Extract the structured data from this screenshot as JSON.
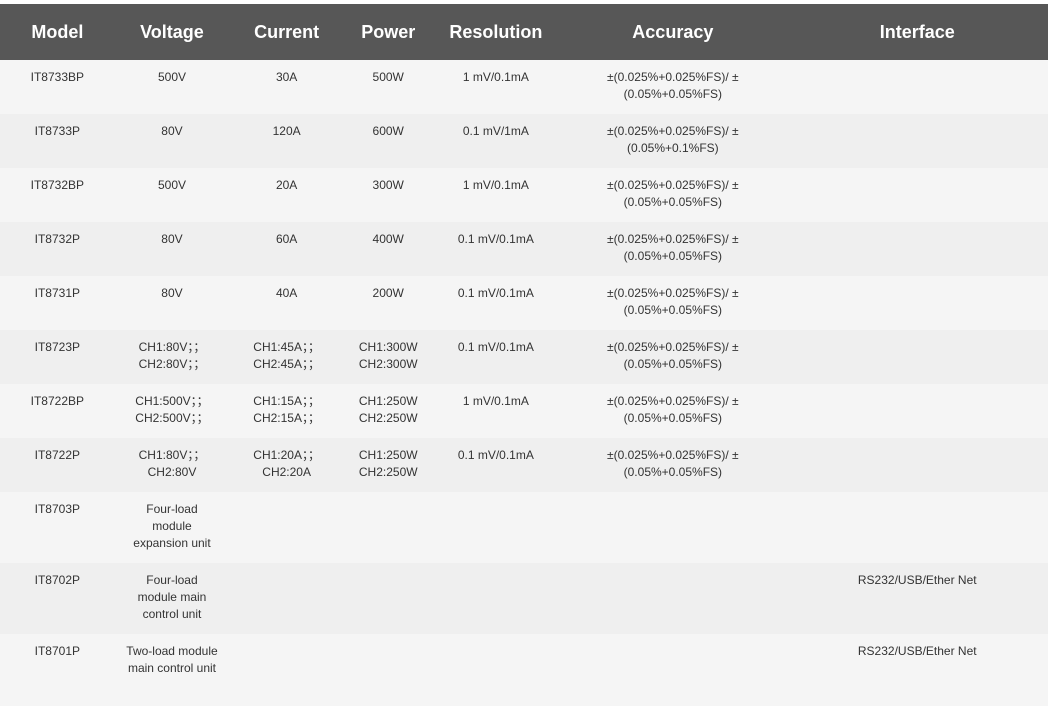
{
  "headers": {
    "model": "Model",
    "voltage": "Voltage",
    "current": "Current",
    "power": "Power",
    "resolution": "Resolution",
    "accuracy": "Accuracy",
    "interface": "Interface"
  },
  "rows": [
    {
      "model": "IT8733BP",
      "voltage": [
        "500V"
      ],
      "current": [
        "30A"
      ],
      "power": [
        "500W"
      ],
      "resolution": "1 mV/0.1mA",
      "accuracy": [
        "±(0.025%+0.025%FS)/ ±",
        "(0.05%+0.05%FS)"
      ],
      "interface": ""
    },
    {
      "model": "IT8733P",
      "voltage": [
        "80V"
      ],
      "current": [
        "120A"
      ],
      "power": [
        "600W"
      ],
      "resolution": "0.1 mV/1mA",
      "accuracy": [
        "±(0.025%+0.025%FS)/ ±",
        "(0.05%+0.1%FS)"
      ],
      "interface": ""
    },
    {
      "model": "IT8732BP",
      "voltage": [
        "500V"
      ],
      "current": [
        "20A"
      ],
      "power": [
        "300W"
      ],
      "resolution": "1 mV/0.1mA",
      "accuracy": [
        "±(0.025%+0.025%FS)/ ±",
        "(0.05%+0.05%FS)"
      ],
      "interface": ""
    },
    {
      "model": "IT8732P",
      "voltage": [
        "80V"
      ],
      "current": [
        "60A"
      ],
      "power": [
        "400W"
      ],
      "resolution": "0.1 mV/0.1mA",
      "accuracy": [
        "±(0.025%+0.025%FS)/ ±",
        "(0.05%+0.05%FS)"
      ],
      "interface": ""
    },
    {
      "model": "IT8731P",
      "voltage": [
        "80V"
      ],
      "current": [
        "40A"
      ],
      "power": [
        "200W"
      ],
      "resolution": "0.1 mV/0.1mA",
      "accuracy": [
        "±(0.025%+0.025%FS)/ ±",
        "(0.05%+0.05%FS)"
      ],
      "interface": ""
    },
    {
      "model": "IT8723P",
      "voltage": [
        "CH1:80V；；",
        "CH2:80V；；"
      ],
      "current": [
        "CH1:45A；；",
        "CH2:45A；；"
      ],
      "power": [
        "CH1:300W",
        "CH2:300W"
      ],
      "resolution": "0.1 mV/0.1mA",
      "accuracy": [
        "±(0.025%+0.025%FS)/ ±",
        "(0.05%+0.05%FS)"
      ],
      "interface": ""
    },
    {
      "model": "IT8722BP",
      "voltage": [
        "CH1:500V；；",
        "CH2:500V；；"
      ],
      "current": [
        "CH1:15A；；",
        "CH2:15A；；"
      ],
      "power": [
        "CH1:250W",
        "CH2:250W"
      ],
      "resolution": "1 mV/0.1mA",
      "accuracy": [
        "±(0.025%+0.025%FS)/ ±",
        "(0.05%+0.05%FS)"
      ],
      "interface": ""
    },
    {
      "model": "IT8722P",
      "voltage": [
        "CH1:80V；；",
        "CH2:80V"
      ],
      "current": [
        "CH1:20A；；",
        "CH2:20A"
      ],
      "power": [
        "CH1:250W",
        "CH2:250W"
      ],
      "resolution": "0.1 mV/0.1mA",
      "accuracy": [
        "±(0.025%+0.025%FS)/ ±",
        "(0.05%+0.05%FS)"
      ],
      "interface": ""
    },
    {
      "model": "IT8703P",
      "voltage": [
        "Four-load",
        "module",
        "expansion unit"
      ],
      "current": [],
      "power": [],
      "resolution": "",
      "accuracy": [],
      "interface": ""
    },
    {
      "model": "IT8702P",
      "voltage": [
        "Four-load",
        "module main",
        "control unit"
      ],
      "current": [],
      "power": [],
      "resolution": "",
      "accuracy": [],
      "interface": "RS232/USB/Ether Net"
    },
    {
      "model": "IT8701P",
      "voltage": [
        "Two-load module",
        "main control unit"
      ],
      "current": [],
      "power": [],
      "resolution": "",
      "accuracy": [],
      "interface": "RS232/USB/Ether Net"
    }
  ]
}
